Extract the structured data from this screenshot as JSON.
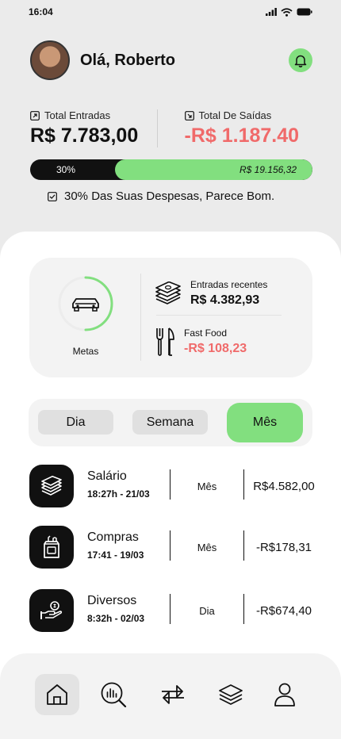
{
  "status": {
    "time": "16:04"
  },
  "header": {
    "greeting": "Olá, Roberto"
  },
  "summary": {
    "income_label": "Total Entradas",
    "income_value": "R$ 7.783,00",
    "expense_label": "Total De Saídas",
    "expense_value": "-R$ 1.187.40"
  },
  "progress": {
    "percent_label": "30%",
    "fraction": 0.3,
    "total": "R$ 19.156,32"
  },
  "note": "30% Das Suas Despesas, Parece Bom.",
  "card": {
    "goal_label": "Metas",
    "recent_label": "Entradas recentes",
    "recent_value": "R$ 4.382,93",
    "food_label": "Fast Food",
    "food_value": "-R$ 108,23"
  },
  "segments": {
    "day": "Dia",
    "week": "Semana",
    "month": "Mês"
  },
  "transactions": [
    {
      "title": "Salário",
      "date": "18:27h - 21/03",
      "period": "Mês",
      "amount": "R$4.582,00",
      "icon": "money-stack-icon"
    },
    {
      "title": "Compras",
      "date": "17:41 - 19/03",
      "period": "Mês",
      "amount": "-R$178,31",
      "icon": "grocery-bag-icon"
    },
    {
      "title": "Diversos",
      "date": "8:32h - 02/03",
      "period": "Dia",
      "amount": "-R$674,40",
      "icon": "hand-money-icon"
    }
  ],
  "nav": [
    "home-icon",
    "analysis-icon",
    "transfer-icon",
    "layers-icon",
    "profile-icon"
  ],
  "colors": {
    "accent": "#82df7f",
    "negative": "#f06a6a",
    "dark": "#111111"
  }
}
